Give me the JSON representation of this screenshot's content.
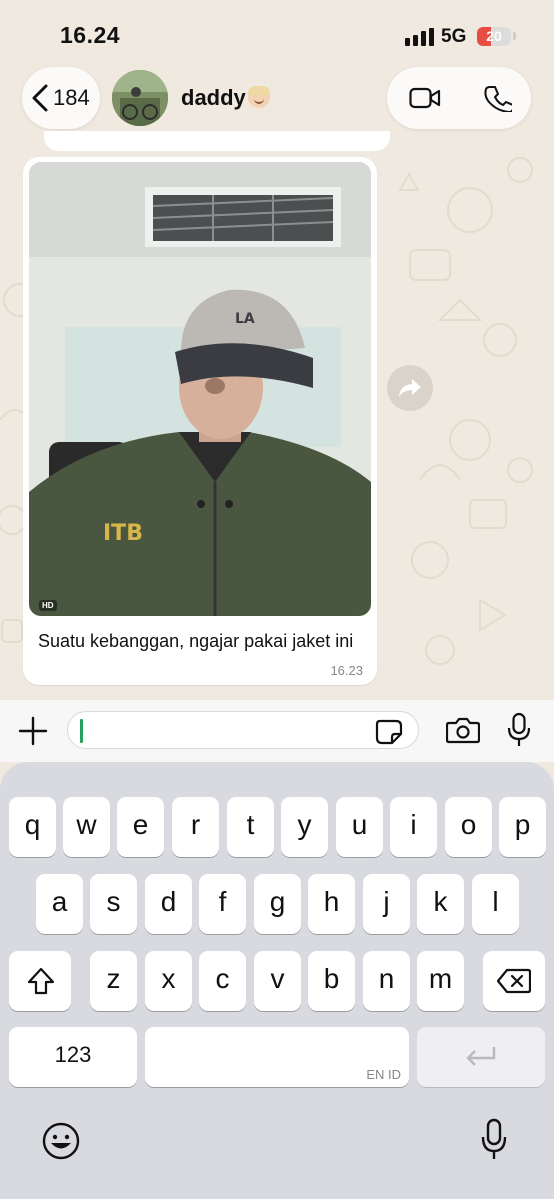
{
  "status_bar": {
    "time": "16.24",
    "network": "5G",
    "battery": "20",
    "battery_fraction": 0.2
  },
  "header": {
    "back_count": "184",
    "contact_name": "daddy",
    "icons": [
      "chevron-left-icon",
      "video-call-icon",
      "phone-icon"
    ]
  },
  "message": {
    "caption": "Suatu kebanggan, ngajar pakai jaket ini",
    "time": "16.23",
    "hd_badge": "HD",
    "photo_jacket_text": "ITB"
  },
  "input_bar": {
    "placeholder": "",
    "icons": [
      "plus-icon",
      "sticker-icon",
      "camera-icon",
      "microphone-icon"
    ]
  },
  "keyboard": {
    "row1": [
      "q",
      "w",
      "e",
      "r",
      "t",
      "y",
      "u",
      "i",
      "o",
      "p"
    ],
    "row2": [
      "a",
      "s",
      "d",
      "f",
      "g",
      "h",
      "j",
      "k",
      "l"
    ],
    "row3": [
      "z",
      "x",
      "c",
      "v",
      "b",
      "n",
      "m"
    ],
    "numbers_key": "123",
    "language": "EN ID"
  },
  "colors": {
    "chat_bg": "#efe9df",
    "accent": "#25a15b",
    "battery_low": "#e84d43"
  }
}
